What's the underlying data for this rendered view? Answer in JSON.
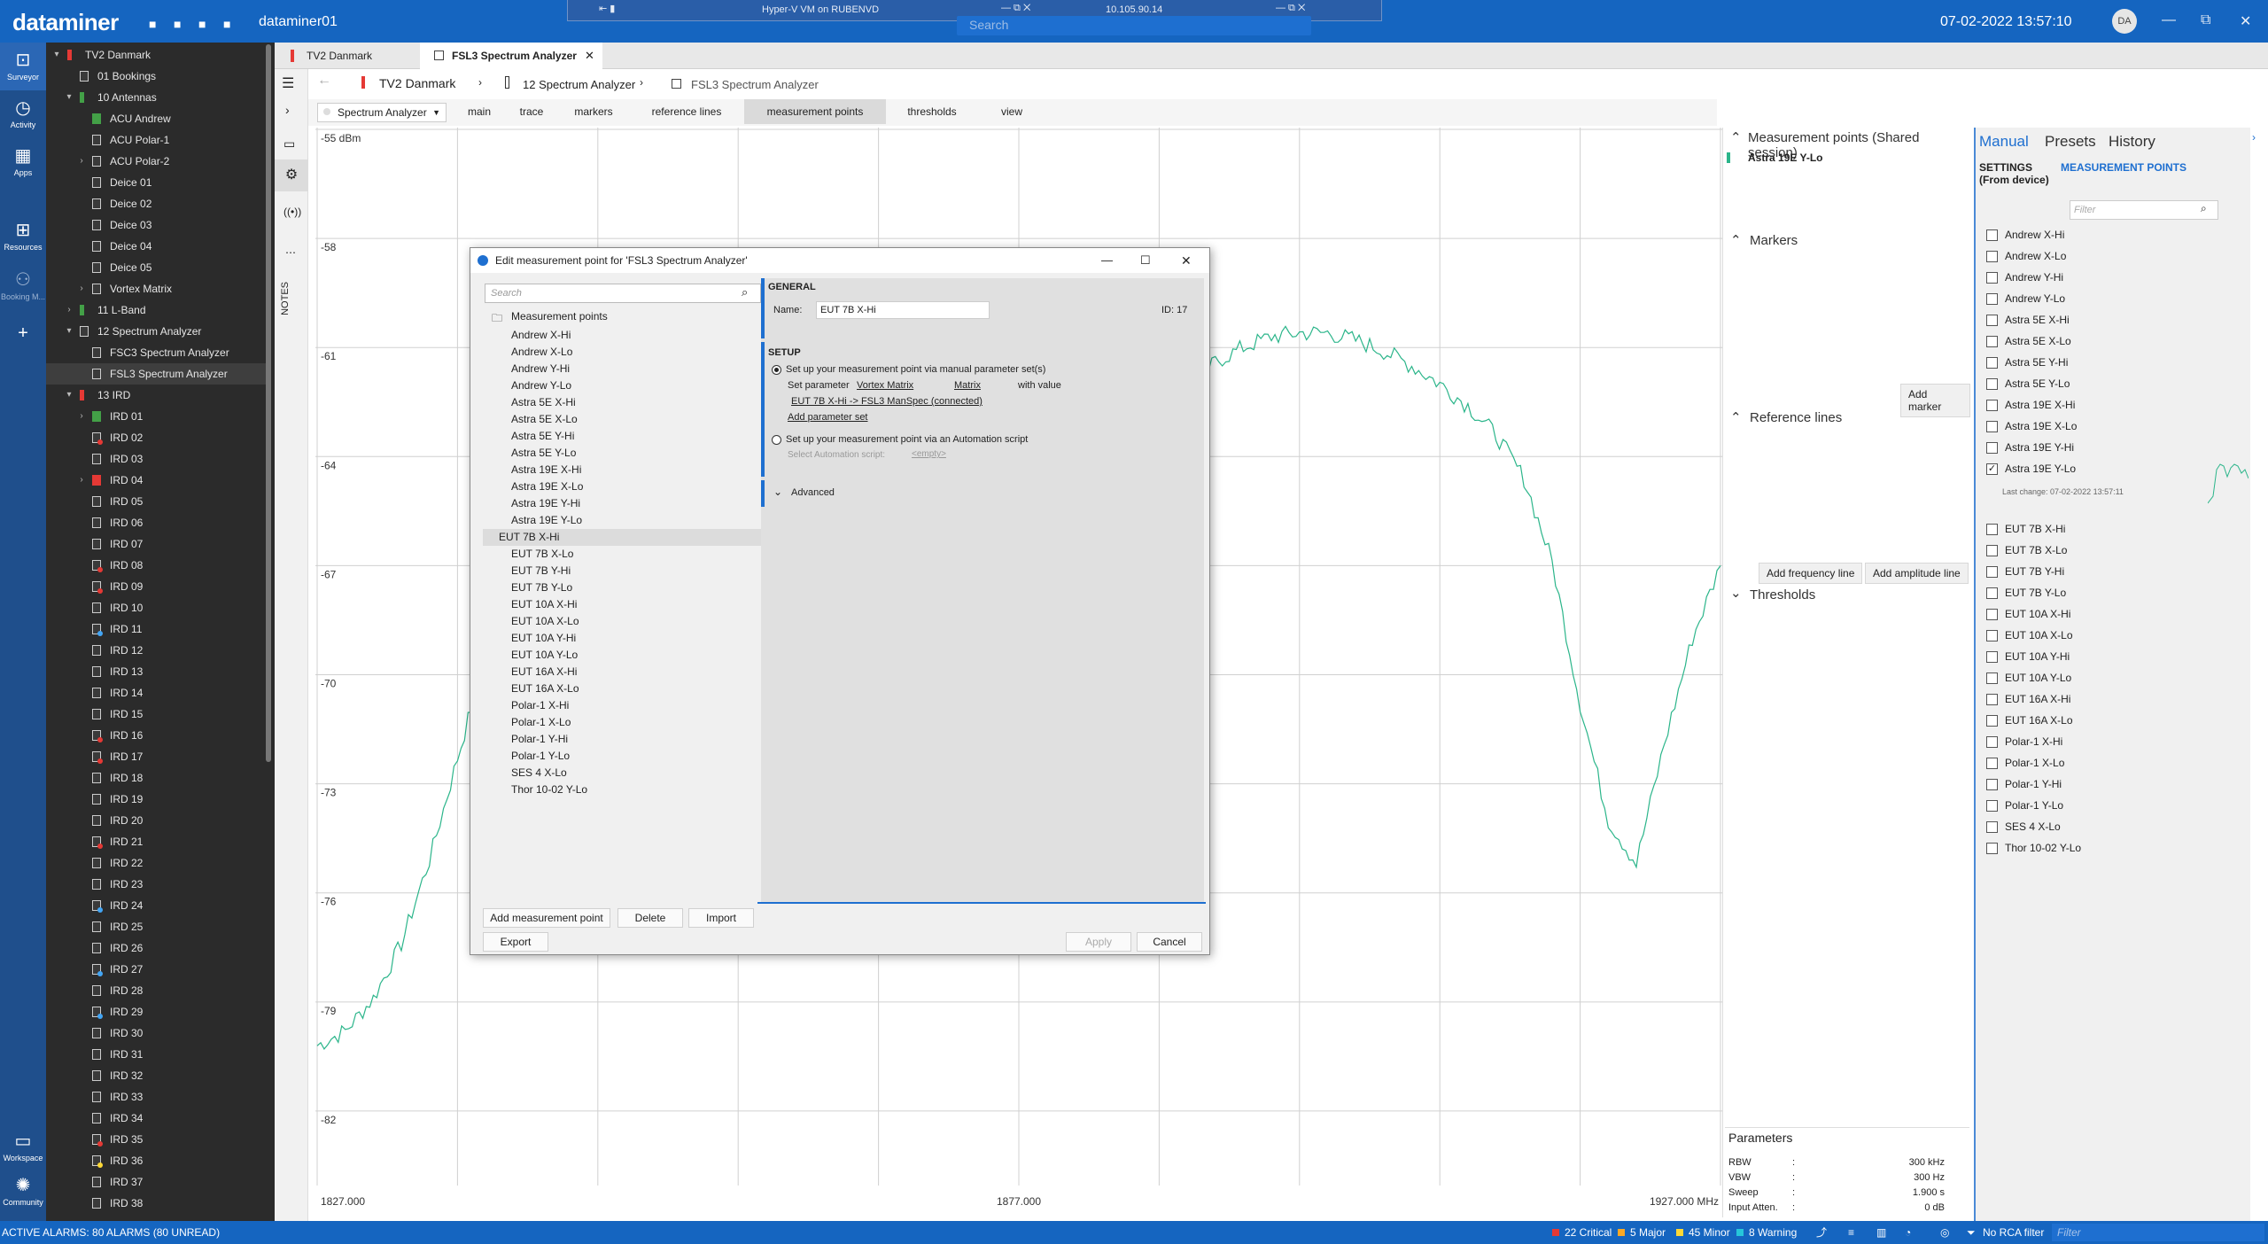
{
  "app": {
    "brand": "dataminer",
    "agent": "dataminer01",
    "datetime": "07-02-2022 13:57:10",
    "user_initials": "DA",
    "hyperv_title": "Hyper-V VM on RUBENVD",
    "hyperv_ip": "10.105.90.14",
    "search_placeholder": "Search"
  },
  "rail": {
    "items": [
      {
        "label": "Surveyor",
        "icon": "surveyor-icon"
      },
      {
        "label": "Activity",
        "icon": "activity-icon"
      },
      {
        "label": "Apps",
        "icon": "apps-icon"
      },
      {
        "label": "Resources",
        "icon": "resources-icon"
      },
      {
        "label": "Booking M...",
        "icon": "booking-icon"
      },
      {
        "label": "Workspace",
        "icon": "workspace-icon"
      },
      {
        "label": "Community",
        "icon": "community-icon"
      }
    ]
  },
  "surveyor": {
    "items": [
      {
        "label": "TV2 Danmark",
        "level": 0,
        "arrow": "▾",
        "state": "crit"
      },
      {
        "label": "01 Bookings",
        "level": 1,
        "arrow": "",
        "state": "none"
      },
      {
        "label": "10 Antennas",
        "level": 1,
        "arrow": "▾",
        "state": "ok"
      },
      {
        "label": "ACU Andrew",
        "level": 2,
        "arrow": "",
        "state": "ok"
      },
      {
        "label": "ACU Polar-1",
        "level": 2,
        "arrow": "",
        "state": "none"
      },
      {
        "label": "ACU Polar-2",
        "level": 2,
        "arrow": "›",
        "state": "none"
      },
      {
        "label": "Deice 01",
        "level": 2,
        "arrow": "",
        "state": "none"
      },
      {
        "label": "Deice 02",
        "level": 2,
        "arrow": "",
        "state": "none"
      },
      {
        "label": "Deice 03",
        "level": 2,
        "arrow": "",
        "state": "none"
      },
      {
        "label": "Deice 04",
        "level": 2,
        "arrow": "",
        "state": "none"
      },
      {
        "label": "Deice 05",
        "level": 2,
        "arrow": "",
        "state": "none"
      },
      {
        "label": "Vortex Matrix",
        "level": 2,
        "arrow": "›",
        "state": "none"
      },
      {
        "label": "11 L-Band",
        "level": 1,
        "arrow": "›",
        "state": "ok"
      },
      {
        "label": "12 Spectrum Analyzer",
        "level": 1,
        "arrow": "▾",
        "state": "none"
      },
      {
        "label": "FSC3 Spectrum Analyzer",
        "level": 2,
        "arrow": "",
        "state": "none"
      },
      {
        "label": "FSL3 Spectrum Analyzer",
        "level": 2,
        "arrow": "",
        "state": "none",
        "selected": true
      },
      {
        "label": "13 IRD",
        "level": 1,
        "arrow": "▾",
        "state": "crit"
      },
      {
        "label": "IRD 01",
        "level": 2,
        "arrow": "›",
        "state": "ok"
      },
      {
        "label": "IRD 02",
        "level": 2,
        "arrow": "",
        "state": "dot-red"
      },
      {
        "label": "IRD 03",
        "level": 2,
        "arrow": "",
        "state": "none"
      },
      {
        "label": "IRD 04",
        "level": 2,
        "arrow": "›",
        "state": "crit-fill"
      },
      {
        "label": "IRD 05",
        "level": 2,
        "arrow": "",
        "state": "none"
      },
      {
        "label": "IRD 06",
        "level": 2,
        "arrow": "",
        "state": "none"
      },
      {
        "label": "IRD 07",
        "level": 2,
        "arrow": "",
        "state": "none"
      },
      {
        "label": "IRD 08",
        "level": 2,
        "arrow": "",
        "state": "dot-red"
      },
      {
        "label": "IRD 09",
        "level": 2,
        "arrow": "",
        "state": "dot-red"
      },
      {
        "label": "IRD 10",
        "level": 2,
        "arrow": "",
        "state": "none"
      },
      {
        "label": "IRD 11",
        "level": 2,
        "arrow": "",
        "state": "dot-blue"
      },
      {
        "label": "IRD 12",
        "level": 2,
        "arrow": "",
        "state": "none"
      },
      {
        "label": "IRD 13",
        "level": 2,
        "arrow": "",
        "state": "none"
      },
      {
        "label": "IRD 14",
        "level": 2,
        "arrow": "",
        "state": "none"
      },
      {
        "label": "IRD 15",
        "level": 2,
        "arrow": "",
        "state": "none"
      },
      {
        "label": "IRD 16",
        "level": 2,
        "arrow": "",
        "state": "dot-red"
      },
      {
        "label": "IRD 17",
        "level": 2,
        "arrow": "",
        "state": "dot-red"
      },
      {
        "label": "IRD 18",
        "level": 2,
        "arrow": "",
        "state": "none"
      },
      {
        "label": "IRD 19",
        "level": 2,
        "arrow": "",
        "state": "none"
      },
      {
        "label": "IRD 20",
        "level": 2,
        "arrow": "",
        "state": "none"
      },
      {
        "label": "IRD 21",
        "level": 2,
        "arrow": "",
        "state": "dot-red"
      },
      {
        "label": "IRD 22",
        "level": 2,
        "arrow": "",
        "state": "none"
      },
      {
        "label": "IRD 23",
        "level": 2,
        "arrow": "",
        "state": "none"
      },
      {
        "label": "IRD 24",
        "level": 2,
        "arrow": "",
        "state": "dot-blue"
      },
      {
        "label": "IRD 25",
        "level": 2,
        "arrow": "",
        "state": "none"
      },
      {
        "label": "IRD 26",
        "level": 2,
        "arrow": "",
        "state": "none"
      },
      {
        "label": "IRD 27",
        "level": 2,
        "arrow": "",
        "state": "dot-blue"
      },
      {
        "label": "IRD 28",
        "level": 2,
        "arrow": "",
        "state": "none"
      },
      {
        "label": "IRD 29",
        "level": 2,
        "arrow": "",
        "state": "dot-blue"
      },
      {
        "label": "IRD 30",
        "level": 2,
        "arrow": "",
        "state": "none"
      },
      {
        "label": "IRD 31",
        "level": 2,
        "arrow": "",
        "state": "none"
      },
      {
        "label": "IRD 32",
        "level": 2,
        "arrow": "",
        "state": "none"
      },
      {
        "label": "IRD 33",
        "level": 2,
        "arrow": "",
        "state": "none"
      },
      {
        "label": "IRD 34",
        "level": 2,
        "arrow": "",
        "state": "none"
      },
      {
        "label": "IRD 35",
        "level": 2,
        "arrow": "",
        "state": "dot-red"
      },
      {
        "label": "IRD 36",
        "level": 2,
        "arrow": "",
        "state": "dot-yellow"
      },
      {
        "label": "IRD 37",
        "level": 2,
        "arrow": "",
        "state": "none"
      },
      {
        "label": "IRD 38",
        "level": 2,
        "arrow": "",
        "state": "none"
      }
    ]
  },
  "tabs": [
    {
      "label": "TV2 Danmark",
      "active": false
    },
    {
      "label": "FSL3 Spectrum Analyzer",
      "active": true
    }
  ],
  "breadcrumb": [
    "TV2 Danmark",
    "12 Spectrum Analyzer",
    "FSL3 Spectrum Analyzer"
  ],
  "notes_label": "NOTES",
  "pages": {
    "analyzer_select": "Spectrum Analyzer",
    "items": [
      "main",
      "trace",
      "markers",
      "reference lines",
      "measurement points",
      "thresholds",
      "view"
    ],
    "active": "measurement points"
  },
  "chart_data": {
    "type": "line",
    "yunit": "-55 dBm",
    "y_ticks": [
      "-55 dBm",
      "-58",
      "-61",
      "-64",
      "-67",
      "-70",
      "-73",
      "-76",
      "-79",
      "-82"
    ],
    "x_ticks": [
      "1827.000",
      "1877.000",
      "1927.000 MHz"
    ],
    "ylim": [
      -84,
      -55
    ],
    "xlim": [
      1827,
      1927
    ],
    "grid": true,
    "color": "#2bb58a",
    "series": [
      {
        "x": [
          1827,
          1829,
          1831,
          1833,
          1835,
          1837,
          1839,
          1841,
          1843,
          1845,
          1847,
          1849,
          1851,
          1853,
          1855,
          1857,
          1859,
          1861,
          1863,
          1865,
          1867,
          1869,
          1871,
          1873,
          1875,
          1877,
          1879,
          1881,
          1883,
          1885,
          1887,
          1889,
          1891,
          1893,
          1895,
          1897,
          1899,
          1901,
          1903,
          1905,
          1907,
          1909,
          1911,
          1913,
          1915,
          1917,
          1919,
          1921,
          1923,
          1925,
          1927
        ],
        "y": [
          -80.2,
          -79.8,
          -78.9,
          -77.4,
          -75.1,
          -72.3,
          -69.5,
          -67.7,
          -66.6,
          -66.2,
          -66.9,
          -67.8,
          -68.6,
          -69.3,
          -70.0,
          -70.4,
          -70.7,
          -70.9,
          -71.2,
          -71.5,
          -71.8,
          -72.2,
          -72.6,
          -73.0,
          -73.6,
          -74.5,
          -75.6,
          -75.0,
          -71.6,
          -67.2,
          -64.0,
          -62.3,
          -61.4,
          -61.0,
          -60.7,
          -60.6,
          -60.6,
          -60.8,
          -61.1,
          -61.5,
          -62.0,
          -62.6,
          -63.4,
          -64.6,
          -66.9,
          -70.8,
          -74.0,
          -75.2,
          -71.9,
          -69.0,
          -67.0
        ]
      }
    ]
  },
  "mpanel": {
    "mp_title": "Measurement points (Shared session)",
    "mp_active": "Astra 19E Y-Lo",
    "markers_title": "Markers",
    "add_marker": "Add marker",
    "ref_title": "Reference lines",
    "add_freq": "Add frequency line",
    "add_amp": "Add amplitude line",
    "thresholds_title": "Thresholds",
    "params_title": "Parameters",
    "params": [
      {
        "name": "RBW",
        "sep": ":",
        "value": "300 kHz"
      },
      {
        "name": "VBW",
        "sep": ":",
        "value": "300 Hz"
      },
      {
        "name": "Sweep",
        "sep": ":",
        "value": "1.900 s"
      },
      {
        "name": "Input Atten.",
        "sep": ":",
        "value": "0 dB"
      }
    ]
  },
  "rpanel": {
    "tabs": [
      "Manual",
      "Presets",
      "History"
    ],
    "settings_label": "SETTINGS",
    "settings_sub": "(From device)",
    "mp_label": "MEASUREMENT POINTS",
    "filter_placeholder": "Filter",
    "last_change": "Last change: 07-02-2022 13:57:11",
    "group1": [
      {
        "label": "Andrew X-Hi",
        "checked": false
      },
      {
        "label": "Andrew X-Lo",
        "checked": false
      },
      {
        "label": "Andrew Y-Hi",
        "checked": false
      },
      {
        "label": "Andrew Y-Lo",
        "checked": false
      },
      {
        "label": "Astra 5E X-Hi",
        "checked": false
      },
      {
        "label": "Astra 5E X-Lo",
        "checked": false
      },
      {
        "label": "Astra 5E Y-Hi",
        "checked": false
      },
      {
        "label": "Astra 5E Y-Lo",
        "checked": false
      },
      {
        "label": "Astra 19E X-Hi",
        "checked": false
      },
      {
        "label": "Astra 19E X-Lo",
        "checked": false
      },
      {
        "label": "Astra 19E Y-Hi",
        "checked": false
      },
      {
        "label": "Astra 19E Y-Lo",
        "checked": true
      }
    ],
    "group2": [
      {
        "label": "EUT 7B X-Hi",
        "checked": false
      },
      {
        "label": "EUT 7B X-Lo",
        "checked": false
      },
      {
        "label": "EUT 7B Y-Hi",
        "checked": false
      },
      {
        "label": "EUT 7B Y-Lo",
        "checked": false
      },
      {
        "label": "EUT 10A X-Hi",
        "checked": false
      },
      {
        "label": "EUT 10A X-Lo",
        "checked": false
      },
      {
        "label": "EUT 10A Y-Hi",
        "checked": false
      },
      {
        "label": "EUT 10A Y-Lo",
        "checked": false
      },
      {
        "label": "EUT 16A X-Hi",
        "checked": false
      },
      {
        "label": "EUT 16A X-Lo",
        "checked": false
      },
      {
        "label": "Polar-1 X-Hi",
        "checked": false
      },
      {
        "label": "Polar-1 X-Lo",
        "checked": false
      },
      {
        "label": "Polar-1 Y-Hi",
        "checked": false
      },
      {
        "label": "Polar-1 Y-Lo",
        "checked": false
      },
      {
        "label": "SES 4 X-Lo",
        "checked": false
      },
      {
        "label": "Thor 10-02 Y-Lo",
        "checked": false
      }
    ]
  },
  "dialog": {
    "title": "Edit measurement point for 'FSL3 Spectrum Analyzer'",
    "search_placeholder": "Search",
    "root_label": "Measurement points",
    "items": [
      "Andrew X-Hi",
      "Andrew X-Lo",
      "Andrew Y-Hi",
      "Andrew Y-Lo",
      "Astra 5E X-Hi",
      "Astra 5E X-Lo",
      "Astra 5E Y-Hi",
      "Astra 5E Y-Lo",
      "Astra 19E X-Hi",
      "Astra 19E X-Lo",
      "Astra 19E Y-Hi",
      "Astra 19E Y-Lo",
      "EUT 7B X-Hi",
      "EUT 7B X-Lo",
      "EUT 7B Y-Hi",
      "EUT 7B Y-Lo",
      "EUT 10A X-Hi",
      "EUT 10A X-Lo",
      "EUT 10A Y-Hi",
      "EUT 10A Y-Lo",
      "EUT 16A X-Hi",
      "EUT 16A X-Lo",
      "Polar-1 X-Hi",
      "Polar-1 X-Lo",
      "Polar-1 Y-Hi",
      "Polar-1 Y-Lo",
      "SES 4 X-Lo",
      "Thor 10-02 Y-Lo"
    ],
    "selected": "EUT 7B X-Hi",
    "general_title": "GENERAL",
    "name_label": "Name:",
    "name_value": "EUT 7B X-Hi",
    "id_label": "ID: 17",
    "setup_title": "SETUP",
    "option1": "Set up your measurement point via manual parameter set(s)",
    "set_param_label": "Set parameter",
    "set_param_element": "Vortex Matrix",
    "set_param_param": "Matrix",
    "with_value": "with value",
    "param_value": "EUT 7B X-Hi -> FSL3 ManSpec (connected)",
    "add_param_set": "Add parameter set",
    "option2": "Set up your measurement point via an Automation script",
    "select_script": "Select Automation script:",
    "empty": "<empty>",
    "advanced": "Advanced",
    "btn_add": "Add measurement point",
    "btn_delete": "Delete",
    "btn_import": "Import",
    "btn_export": "Export",
    "btn_apply": "Apply",
    "btn_cancel": "Cancel"
  },
  "status": {
    "alarms": "ACTIVE ALARMS: 80 ALARMS (80 UNREAD)",
    "critical": "22 Critical",
    "major": "5 Major",
    "minor": "45 Minor",
    "warning": "8 Warning",
    "rca": "No RCA filter",
    "filter_placeholder": "Filter"
  }
}
